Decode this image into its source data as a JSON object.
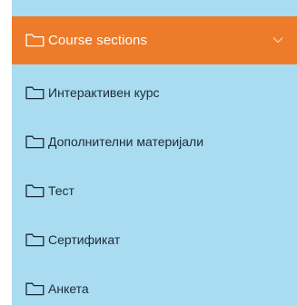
{
  "header": {
    "label": "Course sections",
    "icon": "folder-icon",
    "toggle_icon": "chevron-down-icon",
    "color": "#ee7b2a"
  },
  "sections": [
    {
      "label": "Интерактивен курс"
    },
    {
      "label": "Дополнителни материјали"
    },
    {
      "label": "Тест"
    },
    {
      "label": "Сертификат"
    },
    {
      "label": "Анкета"
    }
  ],
  "colors": {
    "menu_background": "#a9dcf1",
    "header_background": "#ee7b2a",
    "item_text": "#1d2a36"
  }
}
